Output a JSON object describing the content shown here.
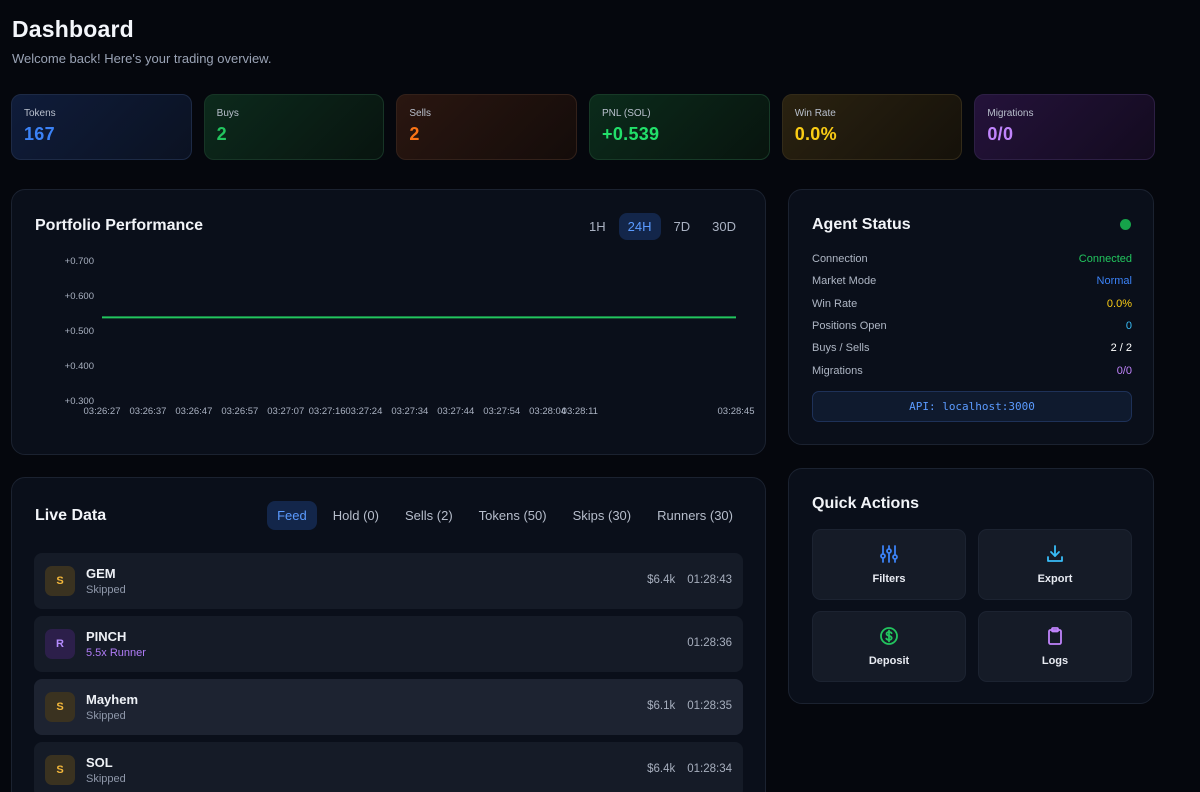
{
  "header": {
    "title": "Dashboard",
    "subtitle": "Welcome back! Here's your trading overview."
  },
  "stats": [
    {
      "label": "Tokens",
      "value": "167"
    },
    {
      "label": "Buys",
      "value": "2"
    },
    {
      "label": "Sells",
      "value": "2"
    },
    {
      "label": "PNL (SOL)",
      "value": "+0.539"
    },
    {
      "label": "Win Rate",
      "value": "0.0%"
    },
    {
      "label": "Migrations",
      "value": "0/0"
    }
  ],
  "performance": {
    "title": "Portfolio Performance",
    "ranges": [
      "1H",
      "24H",
      "7D",
      "30D"
    ],
    "active_range": "24H"
  },
  "chart_data": {
    "type": "line",
    "title": "Portfolio Performance",
    "x": [
      "03:26:27",
      "03:26:37",
      "03:26:47",
      "03:26:57",
      "03:27:07",
      "03:27:16",
      "03:27:24",
      "03:27:34",
      "03:27:44",
      "03:27:54",
      "03:28:04",
      "03:28:11",
      "03:28:45"
    ],
    "series": [
      {
        "values": [
          0.539,
          0.539,
          0.539,
          0.539,
          0.539,
          0.539,
          0.539,
          0.539,
          0.539,
          0.539,
          0.539,
          0.539,
          0.539
        ]
      }
    ],
    "y_ticks": [
      "+0.700",
      "+0.600",
      "+0.500",
      "+0.400",
      "+0.300"
    ],
    "ylim": [
      0.3,
      0.7
    ],
    "line_color": "#22c55e",
    "grid": false
  },
  "live": {
    "title": "Live Data",
    "tabs": [
      "Feed",
      "Hold (0)",
      "Sells (2)",
      "Tokens (50)",
      "Skips (30)",
      "Runners (30)"
    ],
    "active_tab": "Feed",
    "rows": [
      {
        "badge": "S",
        "name": "GEM",
        "status": "Skipped",
        "mcap": "$6.4k",
        "time": "01:28:43"
      },
      {
        "badge": "R",
        "name": "PINCH",
        "status": "5.5x Runner",
        "mcap": "",
        "time": "01:28:36"
      },
      {
        "badge": "S",
        "name": "Mayhem",
        "status": "Skipped",
        "mcap": "$6.1k",
        "time": "01:28:35"
      },
      {
        "badge": "S",
        "name": "SOL",
        "status": "Skipped",
        "mcap": "$6.4k",
        "time": "01:28:34"
      }
    ]
  },
  "agent": {
    "title": "Agent Status",
    "rows": [
      {
        "key": "Connection",
        "value": "Connected",
        "color": "#22c55e"
      },
      {
        "key": "Market Mode",
        "value": "Normal",
        "color": "#3b82f6"
      },
      {
        "key": "Win Rate",
        "value": "0.0%",
        "color": "#facc15"
      },
      {
        "key": "Positions Open",
        "value": "0",
        "color": "#38bdf8"
      },
      {
        "key": "Buys / Sells",
        "value": "2 / 2",
        "color": "#ffffff"
      },
      {
        "key": "Migrations",
        "value": "0/0",
        "color": "#c084fc"
      }
    ],
    "api": "API: localhost:3000"
  },
  "quick_actions": {
    "title": "Quick Actions",
    "items": [
      {
        "label": "Filters",
        "icon": "sliders-icon",
        "color": "#3b82f6"
      },
      {
        "label": "Export",
        "icon": "download-icon",
        "color": "#38bdf8"
      },
      {
        "label": "Deposit",
        "icon": "dollar-circle-icon",
        "color": "#22c55e"
      },
      {
        "label": "Logs",
        "icon": "clipboard-icon",
        "color": "#c084fc"
      }
    ]
  }
}
